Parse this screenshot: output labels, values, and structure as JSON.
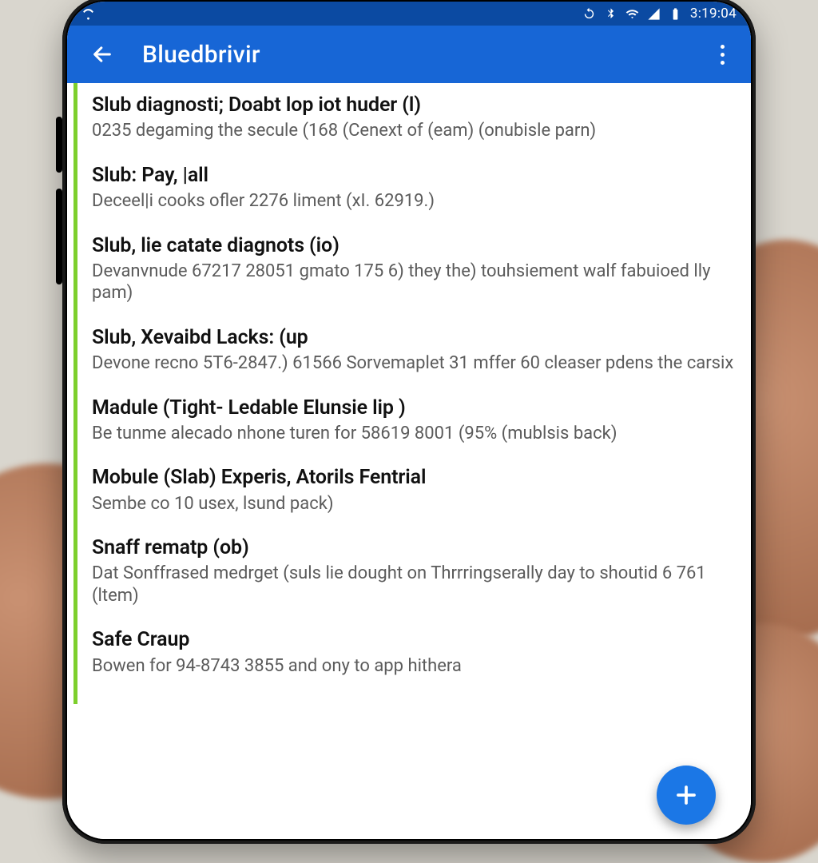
{
  "statusbar": {
    "time": "3:19:04",
    "icons_left": [
      "wifi-activity-icon"
    ],
    "icons_right": [
      "sync-icon",
      "bluetooth-icon",
      "wifi-icon",
      "signal-icon",
      "battery-icon"
    ]
  },
  "appbar": {
    "title": "Bluedbrivir",
    "back_label": "Back",
    "more_label": "More options"
  },
  "list": [
    {
      "title": "Slub diagnosti; Doabt lop iot huder (l)",
      "desc": "0235 degaming the secule (168 (Cenext of (eam) (onubisle parn)"
    },
    {
      "title": "Slub: Pay, |all",
      "desc": "Deceel|i cooks ofler 2276 liment (xI. 62919.)"
    },
    {
      "title": "Slub, lie catate diagnots (io)",
      "desc": "Devanvnude 67217 28051 gmato 175 6) they the) touhsiement walf fabuioed lly pam)"
    },
    {
      "title": "Slub, Xevaibd Lacks: (up",
      "desc": "Devone recno 5T6-2847.)\n61566 Sorvemaplet 31 mffer 60 cleaser pdens the carsix"
    },
    {
      "title": "Madule (Tight- Ledable Elunsie lip )",
      "desc": "Be tunme alecado nhone turen for 58619 8001 (95% (mublsis back)"
    },
    {
      "title": "Mobule (Slab) Experis, Atorils Fentrial",
      "desc": "Sembe co 10 usex, lsund pack)"
    },
    {
      "title": "Snaff rematp (ob)",
      "desc": "Dat Sonffrased medrget (suls lie dought on Thrrringserally day to shoutid 6 761 (ltem)"
    },
    {
      "title": "Safe Craup",
      "desc": "Bowen for 94-8743 3855 and ony to app hithera"
    }
  ],
  "fab": {
    "label": "+"
  },
  "colors": {
    "primary": "#1766d6",
    "primary_dark": "#0b4aa2",
    "accent": "#1b77e6",
    "stripe": "#7dcf2c"
  }
}
